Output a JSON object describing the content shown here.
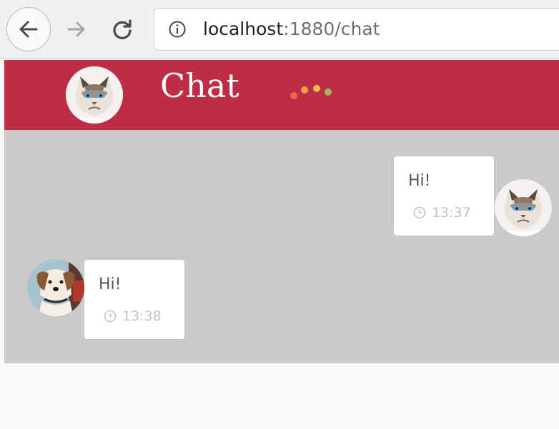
{
  "browser": {
    "url_host": "localhost",
    "url_rest": ":1880/chat"
  },
  "header": {
    "title": "Chat",
    "avatar": "grumpy-cat-avatar",
    "typing_indicator_colors": [
      "#e8684a",
      "#f0a24a",
      "#e8c24a",
      "#9db85a"
    ]
  },
  "colors": {
    "header_bg": "#be2c45",
    "chat_bg": "#cacaca",
    "bubble_bg": "#ffffff",
    "time_text": "#c4c4c4"
  },
  "messages": [
    {
      "text": "Hi!",
      "time": "13:37",
      "side": "right",
      "avatar": "grumpy-cat-avatar"
    },
    {
      "text": "Hi!",
      "time": "13:38",
      "side": "left",
      "avatar": "dog-avatar"
    }
  ]
}
